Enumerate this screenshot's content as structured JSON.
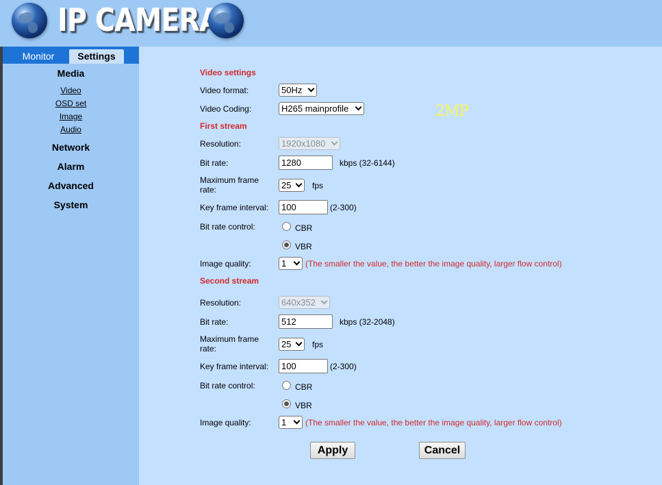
{
  "header": {
    "title": "IP CAMERA",
    "logo_icon": "globe-icon"
  },
  "tabs": [
    {
      "label": "Monitor"
    },
    {
      "label": "Settings",
      "active": true
    }
  ],
  "nav": {
    "media": "Media",
    "media_items": [
      {
        "label": "Video"
      },
      {
        "label": "OSD set"
      },
      {
        "label": "Image"
      },
      {
        "label": "Audio"
      }
    ],
    "network": "Network",
    "alarm": "Alarm",
    "advanced": "Advanced",
    "system": "System"
  },
  "video_settings": {
    "title": "Video settings",
    "format_label": "Video format:",
    "format_value": "50Hz",
    "coding_label": "Video Coding:",
    "coding_value": "H265 mainprofile",
    "badge": "2MP"
  },
  "first_stream": {
    "title": "First stream",
    "resolution_label": "Resolution:",
    "resolution_value": "1920x1080",
    "bitrate_label": "Bit rate:",
    "bitrate_value": "1280",
    "bitrate_hint": "kbps (32-6144)",
    "framerate_label_1": "Maximum frame",
    "framerate_label_2": "rate:",
    "framerate_value": "25",
    "framerate_unit": "fps",
    "keyframe_label": "Key frame interval:",
    "keyframe_value": "100",
    "keyframe_hint": "(2-300)",
    "control_label": "Bit rate control:",
    "cbr_label": "CBR",
    "vbr_label": "VBR",
    "selected_control": "VBR",
    "quality_label": "Image quality:",
    "quality_value": "1",
    "quality_hint": "(The smaller the value, the better the image quality, larger flow control)"
  },
  "second_stream": {
    "title": "Second stream",
    "resolution_label": "Resolution:",
    "resolution_value": "640x352",
    "bitrate_label": "Bit rate:",
    "bitrate_value": "512",
    "bitrate_hint": "kbps (32-2048)",
    "framerate_label_1": "Maximum frame",
    "framerate_label_2": "rate:",
    "framerate_value": "25",
    "framerate_unit": "fps",
    "keyframe_label": "Key frame interval:",
    "keyframe_value": "100",
    "keyframe_hint": "(2-300)",
    "control_label": "Bit rate control:",
    "cbr_label": "CBR",
    "vbr_label": "VBR",
    "selected_control": "VBR",
    "quality_label": "Image quality:",
    "quality_value": "1",
    "quality_hint": "(The smaller the value, the better the image quality, larger flow control)"
  },
  "actions": {
    "apply": "Apply",
    "cancel": "Cancel"
  },
  "colors": {
    "header_bg": "#9ec9f5",
    "tab_bar": "#1e74d6",
    "main_bg": "#c4e0ff",
    "section_red": "#d22a2a",
    "badge_yellow": "#f1f15a"
  }
}
